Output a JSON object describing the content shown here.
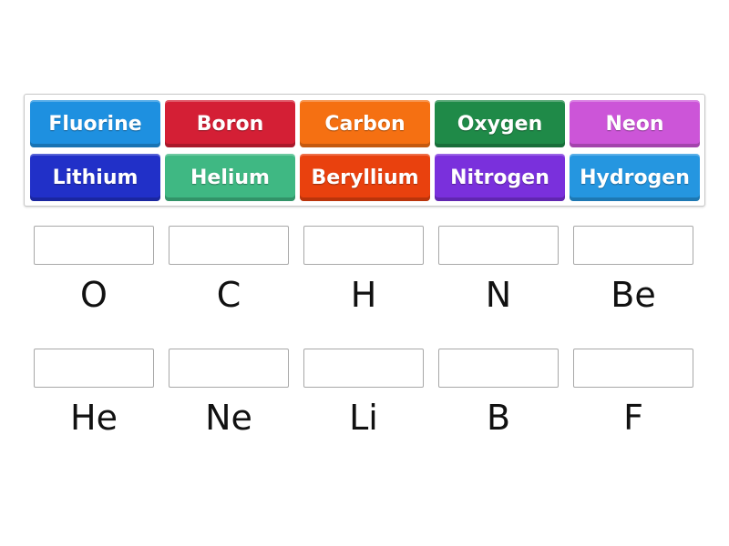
{
  "tiles": [
    {
      "label": "Fluorine",
      "color": "#1e90e0"
    },
    {
      "label": "Boron",
      "color": "#d41f35"
    },
    {
      "label": "Carbon",
      "color": "#f57012"
    },
    {
      "label": "Oxygen",
      "color": "#1f8a48"
    },
    {
      "label": "Neon",
      "color": "#cc55d8"
    },
    {
      "label": "Lithium",
      "color": "#2130c8"
    },
    {
      "label": "Helium",
      "color": "#3fb883"
    },
    {
      "label": "Beryllium",
      "color": "#e9410e"
    },
    {
      "label": "Nitrogen",
      "color": "#7a30dc"
    },
    {
      "label": "Hydrogen",
      "color": "#2596e0"
    }
  ],
  "targets": [
    {
      "symbol": "O"
    },
    {
      "symbol": "C"
    },
    {
      "symbol": "H"
    },
    {
      "symbol": "N"
    },
    {
      "symbol": "Be"
    },
    {
      "symbol": "He"
    },
    {
      "symbol": "Ne"
    },
    {
      "symbol": "Li"
    },
    {
      "symbol": "B"
    },
    {
      "symbol": "F"
    }
  ]
}
